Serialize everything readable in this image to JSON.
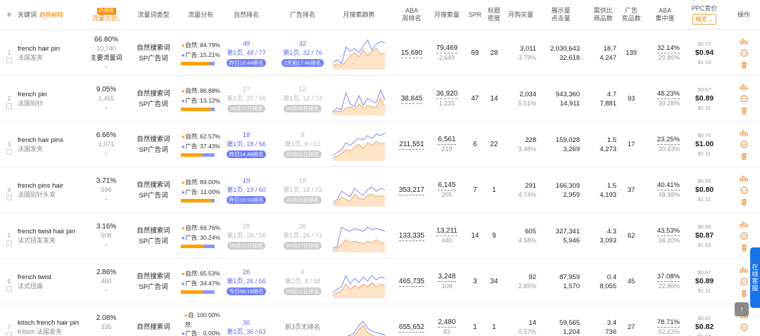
{
  "header": {
    "idx": "#",
    "keyword": "关键词",
    "keyword_tip": "趋势解释",
    "new_tag": "内测版",
    "share": "流量占比",
    "share_arrow": "↓",
    "kw_type": "流量词类型",
    "dist": "流量分布",
    "natural_rank": "自然排名",
    "ad_rank": "广告排名",
    "trend": "月搜索趋势",
    "aba_1": "ABA",
    "aba_2": "周排名",
    "monthly_search": "月搜索量",
    "spr": "SPR",
    "title_1": "标题",
    "title_2": "密度",
    "monthly_buy": "月购买量",
    "impressions_1": "展示量",
    "impressions_2": "点击量",
    "sd_1": "需供比",
    "sd_2": "商品数",
    "ads_1": "广告",
    "ads_2": "竞品数",
    "conc_1": "ABA",
    "conc_2": "集中度",
    "ppc": "PPC竞价",
    "ppc_select": "精准 ⌄",
    "ops": "操作"
  },
  "colors": {
    "orange": "#ffa200",
    "purple": "#8c94ff",
    "blue": "#5b6cf5",
    "accent": "#f08c00"
  },
  "labels": {
    "natural": "自然:",
    "ad": "广告:"
  },
  "rows": [
    {
      "idx": "1",
      "en": "french hair pin",
      "cn": "法国发夹",
      "pct": "66.80%",
      "num": "10,740",
      "tag": "主要流量词",
      "dash": "-",
      "t1": "自然搜索词",
      "t2": "SP广告词",
      "nat_pct": "84.79%",
      "ad_pct": "15.21%",
      "nat_frac": 0.8479,
      "nr_num": "48",
      "nr_pos": "第1页, 48 / 77",
      "nr_pill": "昨日16:44排名",
      "nr_faded": false,
      "ar_num": "32",
      "ar_pos": "第1页, 32 / 76",
      "ar_pill": "2天前17:46排名",
      "ar_faded": false,
      "ar_plain": "",
      "aba": "15,690",
      "vol": "79,469",
      "vol2": "2,649",
      "spr": "69",
      "td": "28",
      "buy": "3,011",
      "buy2": "3.79%",
      "imp": "2,030,643",
      "clk": "32,618",
      "sd": "18.7",
      "goods": "4,247",
      "adc": "139",
      "conc": "32.14%",
      "conc2": "29.86%",
      "ppc_lo": "$0.70",
      "ppc": "$0.94",
      "ppc_hi": "$1.10",
      "trend_a": [
        8,
        12,
        6,
        30,
        24,
        28,
        22,
        32,
        40,
        26,
        34,
        38,
        36
      ],
      "trend_b": [
        4,
        6,
        3,
        10,
        18,
        22,
        16,
        26,
        18,
        24,
        28,
        20,
        22
      ]
    },
    {
      "idx": "2",
      "en": "french pin",
      "cn": "法国别针",
      "pct": "9.05%",
      "num": "1,455",
      "tag": "",
      "dash": "-",
      "t1": "自然搜索词",
      "t2": "SP广告词",
      "nat_pct": "86.88%",
      "ad_pct": "13.12%",
      "nat_frac": 0.8688,
      "nr_num": "27",
      "nr_pos": "第1页, 27 / 56",
      "nr_pill": "05月27日排名",
      "nr_faded": true,
      "ar_num": "12",
      "ar_pos": "第1页, 12 / 74",
      "ar_pill": "05月08日排名",
      "ar_faded": true,
      "ar_plain": "",
      "aba": "38,845",
      "vol": "36,920",
      "vol2": "1,231",
      "spr": "47",
      "td": "14",
      "buy": "2,034",
      "buy2": "5.51%",
      "imp": "943,360",
      "clk": "14,911",
      "sd": "4.7",
      "goods": "7,881",
      "adc": "93",
      "conc": "48.23%",
      "conc2": "39.28%",
      "ppc_lo": "$0.67",
      "ppc": "$0.89",
      "ppc_hi": "$1.11",
      "trend_a": [
        4,
        8,
        6,
        30,
        14,
        10,
        26,
        12,
        22,
        18,
        16,
        34,
        20
      ],
      "trend_b": [
        3,
        4,
        3,
        8,
        10,
        6,
        14,
        8,
        12,
        10,
        9,
        22,
        10
      ]
    },
    {
      "idx": "3",
      "en": "french hair pins",
      "cn": "法国发夹",
      "pct": "6.66%",
      "num": "1,071",
      "tag": "",
      "dash": "-",
      "t1": "自然搜索词",
      "t2": "SP广告词",
      "nat_pct": "62.57%",
      "ad_pct": "37.43%",
      "nat_frac": 0.6257,
      "nr_num": "18",
      "nr_pos": "第1页, 18 / 56",
      "nr_pill": "昨日14:46排名",
      "nr_faded": false,
      "ar_num": "9",
      "ar_pos": "第1页, 9 / 61",
      "ar_pill": "05月21日排名",
      "ar_faded": true,
      "ar_plain": "",
      "aba": "211,551",
      "vol": "6,561",
      "vol2": "219",
      "spr": "6",
      "td": "22",
      "buy": "228",
      "buy2": "3.48%",
      "imp": "159,028",
      "clk": "3,269",
      "sd": "1.5",
      "goods": "4,273",
      "adc": "17",
      "conc": "23.25%",
      "conc2": "20.43%",
      "ppc_lo": "$0.70",
      "ppc": "$1.00",
      "ppc_hi": "$1.11",
      "trend_a": [
        6,
        10,
        14,
        24,
        20,
        26,
        30,
        28,
        34,
        30,
        36,
        34,
        38
      ],
      "trend_b": [
        3,
        5,
        8,
        14,
        12,
        18,
        22,
        16,
        24,
        20,
        26,
        22,
        24
      ]
    },
    {
      "idx": "4",
      "en": "french pins hair",
      "cn": "法国别针头发",
      "pct": "3.71%",
      "num": "596",
      "tag": "",
      "dash": "-",
      "t1": "自然搜索词",
      "t2": "SP广告词",
      "nat_pct": "89.00%",
      "ad_pct": "11.00%",
      "nat_frac": 0.89,
      "nr_num": "19",
      "nr_pos": "第1页, 19 / 60",
      "nr_pill": "昨日16:33排名",
      "nr_faded": false,
      "ar_num": "18",
      "ar_pos": "第1页, 18 / 72",
      "ar_pill": "05月25日排名",
      "ar_faded": true,
      "ar_plain": "",
      "aba": "353,217",
      "vol": "6,145",
      "vol2": "205",
      "spr": "7",
      "td": "1",
      "buy": "291",
      "buy2": "4.74%",
      "imp": "166,309",
      "clk": "2,959",
      "sd": "1.5",
      "goods": "4,193",
      "adc": "37",
      "conc": "40.41%",
      "conc2": "48.98%",
      "ppc_lo": "$0.60",
      "ppc": "$0.80",
      "ppc_hi": "$1.11",
      "trend_a": [
        4,
        8,
        20,
        16,
        12,
        24,
        18,
        14,
        22,
        26,
        20,
        24,
        22
      ],
      "trend_b": [
        2,
        4,
        12,
        8,
        6,
        16,
        10,
        8,
        14,
        16,
        12,
        14,
        12
      ]
    },
    {
      "idx": "5",
      "en": "french twist hair pin",
      "cn": "法式扭发发夹",
      "pct": "3.16%",
      "num": "508",
      "tag": "",
      "dash": "-",
      "t1": "自然搜索词",
      "t2": "SP广告词",
      "nat_pct": "69.76%",
      "ad_pct": "30.24%",
      "nat_frac": 0.6976,
      "nr_num": "28",
      "nr_pos": "第1页, 28 / 56",
      "nr_pill": "05月27日排名",
      "nr_faded": true,
      "ar_num": "26",
      "ar_pos": "第1页, 26 / 71",
      "ar_pill": "05月27日排名",
      "ar_faded": true,
      "ar_plain": "",
      "aba": "133,335",
      "vol": "13,211",
      "vol2": "440",
      "spr": "14",
      "td": "9",
      "buy": "605",
      "buy2": "4.58%",
      "imp": "327,341",
      "clk": "5,946",
      "sd": "4.3",
      "goods": "3,093",
      "adc": "62",
      "conc": "43.53%",
      "conc2": "34.20%",
      "ppc_lo": "$0.65",
      "ppc": "$0.87",
      "ppc_hi": "$1.09",
      "trend_a": [
        4,
        6,
        34,
        30,
        28,
        32,
        30,
        28,
        34,
        30,
        32,
        30,
        28
      ],
      "trend_b": [
        2,
        3,
        10,
        16,
        12,
        14,
        12,
        10,
        14,
        12,
        16,
        12,
        10
      ]
    },
    {
      "idx": "6",
      "en": "french twist",
      "cn": "法式扭曲",
      "pct": "2.86%",
      "num": "460",
      "tag": "",
      "dash": "-",
      "t1": "自然搜索词",
      "t2": "SP广告词",
      "nat_pct": "65.53%",
      "ad_pct": "34.47%",
      "nat_frac": 0.6553,
      "nr_num": "26",
      "nr_pos": "第1页, 26 / 56",
      "nr_pill": "今日06:16排名",
      "nr_faded": false,
      "ar_num": "4",
      "ar_pos": "第1页, 4 / 58",
      "ar_pill": "05月21日排名",
      "ar_faded": true,
      "ar_plain": "",
      "aba": "465,735",
      "vol": "3,248",
      "vol2": "108",
      "spr": "3",
      "td": "34",
      "buy": "92",
      "buy2": "2.85%",
      "imp": "87,959",
      "clk": "1,570",
      "sd": "0.4",
      "goods": "8,055",
      "adc": "45",
      "conc": "37.08%",
      "conc2": "22.86%",
      "ppc_lo": "$0.67",
      "ppc": "$0.89",
      "ppc_hi": "$1.11",
      "trend_a": [
        6,
        10,
        14,
        30,
        18,
        26,
        20,
        28,
        22,
        30,
        24,
        28,
        26
      ],
      "trend_b": [
        3,
        5,
        8,
        18,
        10,
        16,
        12,
        18,
        14,
        20,
        14,
        18,
        16
      ]
    },
    {
      "idx": "7",
      "en": "kitsch french hair pin",
      "cn": "Kitsch 法国发夹",
      "pct": "2.08%",
      "num": "335",
      "tag": "",
      "dash": "-",
      "t1": "自然搜索词",
      "t2": "",
      "nat_pct": "100.00%",
      "ad_pct": "0.00%",
      "nat_frac": 1.0,
      "nr_num": "36",
      "nr_pos": "第1页, 36 / 63",
      "nr_pill": "",
      "nr_faded": false,
      "ar_num": "",
      "ar_pos": "",
      "ar_pill": "",
      "ar_faded": false,
      "ar_plain": "前3页无排名",
      "aba": "655,652",
      "vol": "2,480",
      "vol2": "83",
      "spr": "1",
      "td": "1",
      "buy": "14",
      "buy2": "0.57%",
      "imp": "59,565",
      "clk": "1,204",
      "sd": "3.4",
      "goods": "736",
      "adc": "27",
      "conc": "78.71%",
      "conc2": "52.63%",
      "ppc_lo": "$0.62",
      "ppc": "$0.82",
      "ppc_hi": "$1.04",
      "trend_a": [
        2,
        4,
        6,
        8,
        10,
        14,
        24,
        30,
        20,
        16,
        14,
        12,
        10
      ],
      "trend_b": [
        1,
        2,
        3,
        4,
        6,
        10,
        18,
        24,
        14,
        10,
        8,
        6,
        5
      ]
    }
  ],
  "side_tab": "在线客服",
  "scroll_top": "↑"
}
